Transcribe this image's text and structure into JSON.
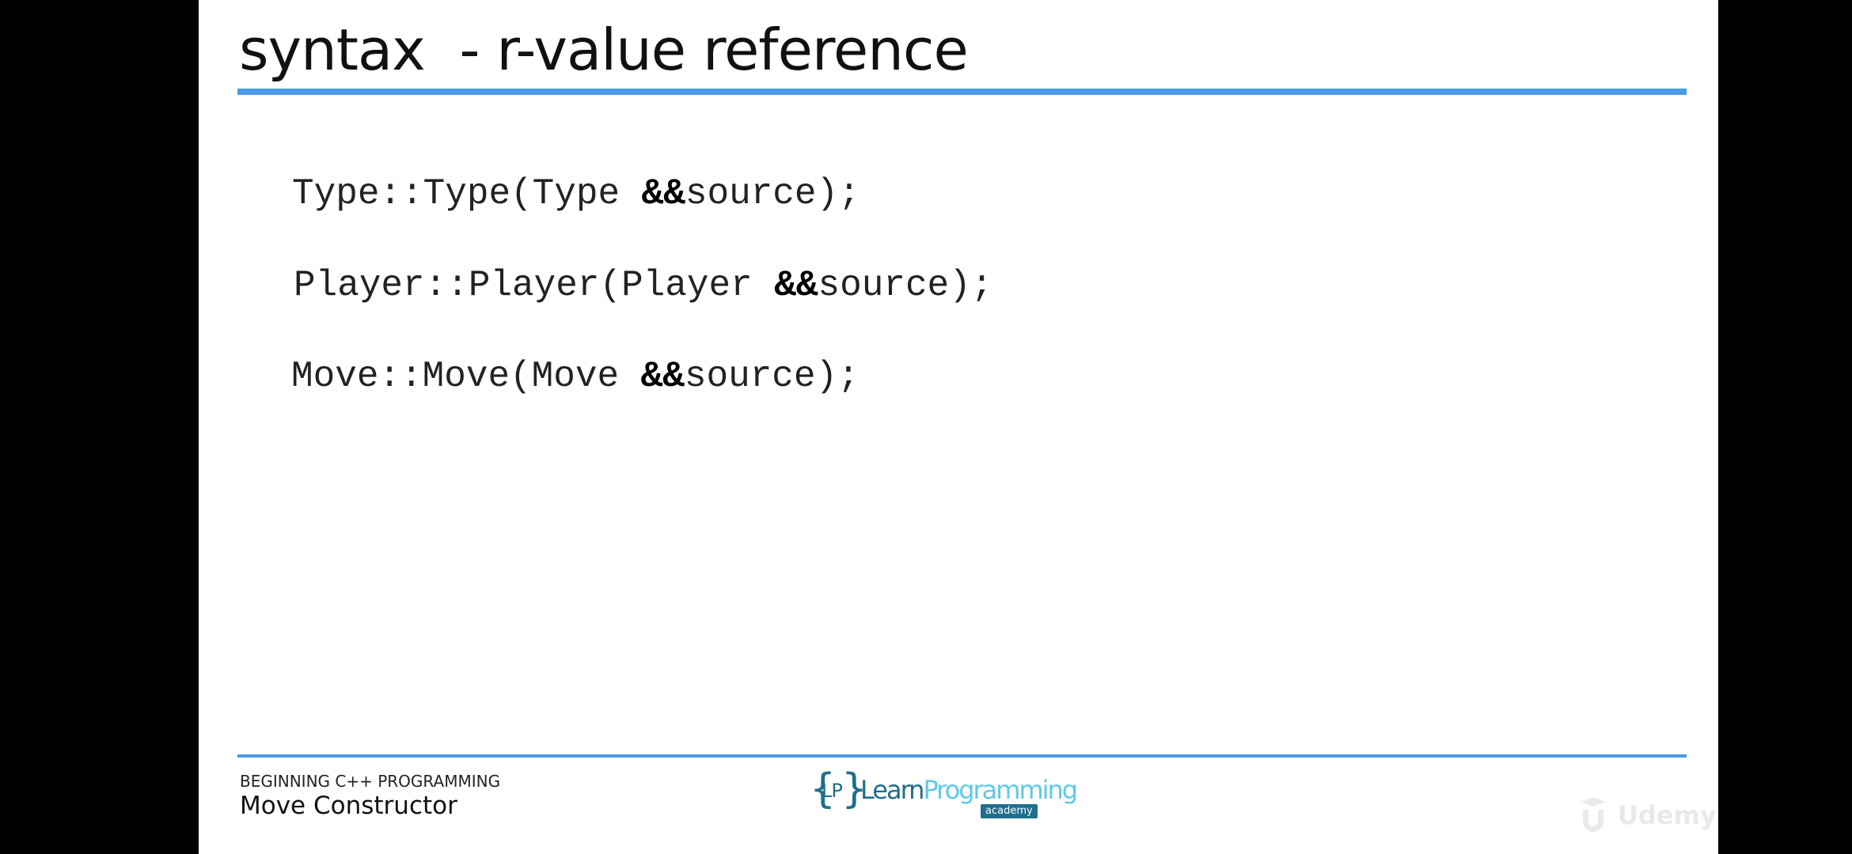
{
  "slide": {
    "title": "syntax  - r-value reference",
    "code_lines": [
      {
        "before": "Type::Type(Type ",
        "ref": "&&",
        "after": "source);"
      },
      {
        "before": "Player::Player(Player ",
        "ref": "&&",
        "after": "source);"
      },
      {
        "before": "Move::Move(Move ",
        "ref": "&&",
        "after": "source);"
      }
    ],
    "footer": {
      "course": "BEGINNING C++ PROGRAMMING",
      "lecture": "Move Constructor",
      "logo": {
        "brace_left": "{",
        "mark": "LP",
        "brace_right": "}",
        "word_learn": "Learn",
        "word_programming": "Programming",
        "badge": "academy"
      }
    }
  },
  "watermark": {
    "text": "Udemy",
    "icon": "udemy-logo-icon"
  },
  "colors": {
    "accent_rule": "#4a9ae6",
    "logo_dark": "#1f6e8c",
    "logo_light": "#5fc9e8",
    "letterbox": "#000000"
  }
}
